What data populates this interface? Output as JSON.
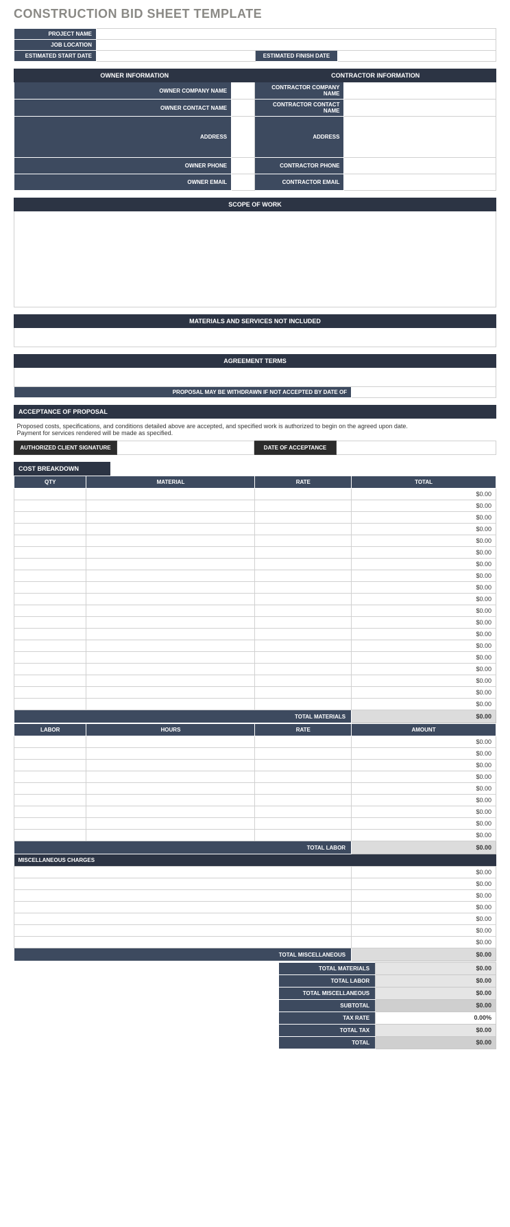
{
  "title": "CONSTRUCTION BID SHEET TEMPLATE",
  "project": {
    "project_name_label": "PROJECT NAME",
    "job_location_label": "JOB LOCATION",
    "est_start_label": "ESTIMATED START DATE",
    "est_finish_label": "ESTIMATED FINISH DATE"
  },
  "owner": {
    "header": "OWNER INFORMATION",
    "company_label": "OWNER COMPANY NAME",
    "contact_label": "OWNER CONTACT NAME",
    "address_label": "ADDRESS",
    "phone_label": "OWNER PHONE",
    "email_label": "OWNER EMAIL"
  },
  "contractor": {
    "header": "CONTRACTOR INFORMATION",
    "company_label": "CONTRACTOR  COMPANY NAME",
    "contact_label": "CONTRACTOR  CONTACT NAME",
    "address_label": "ADDRESS",
    "phone_label": "CONTRACTOR PHONE",
    "email_label": "CONTRACTOR EMAIL"
  },
  "scope_header": "SCOPE OF WORK",
  "not_included_header": "MATERIALS AND SERVICES NOT INCLUDED",
  "agreement_header": "AGREEMENT TERMS",
  "withdraw_label": "PROPOSAL MAY BE WITHDRAWN IF NOT ACCEPTED BY DATE OF",
  "acceptance_header": "ACCEPTANCE OF PROPOSAL",
  "acceptance_text_1": "Proposed costs, specifications, and conditions detailed above are accepted, and specified work is authorized to begin on the agreed upon date.",
  "acceptance_text_2": "Payment for services rendered will be made as specified.",
  "signature_label": "AUTHORIZED CLIENT SIGNATURE",
  "date_accept_label": "DATE OF ACCEPTANCE",
  "cost_breakdown_header": "COST BREAKDOWN",
  "materials_table": {
    "col_qty": "QTY",
    "col_material": "MATERIAL",
    "col_rate": "RATE",
    "col_total": "TOTAL",
    "rows": [
      {
        "total": "$0.00"
      },
      {
        "total": "$0.00"
      },
      {
        "total": "$0.00"
      },
      {
        "total": "$0.00"
      },
      {
        "total": "$0.00"
      },
      {
        "total": "$0.00"
      },
      {
        "total": "$0.00"
      },
      {
        "total": "$0.00"
      },
      {
        "total": "$0.00"
      },
      {
        "total": "$0.00"
      },
      {
        "total": "$0.00"
      },
      {
        "total": "$0.00"
      },
      {
        "total": "$0.00"
      },
      {
        "total": "$0.00"
      },
      {
        "total": "$0.00"
      },
      {
        "total": "$0.00"
      },
      {
        "total": "$0.00"
      },
      {
        "total": "$0.00"
      },
      {
        "total": "$0.00"
      }
    ],
    "subtotal_label": "TOTAL MATERIALS",
    "subtotal_value": "$0.00"
  },
  "labor_table": {
    "col_labor": "LABOR",
    "col_hours": "HOURS",
    "col_rate": "RATE",
    "col_amount": "AMOUNT",
    "rows": [
      {
        "amount": "$0.00"
      },
      {
        "amount": "$0.00"
      },
      {
        "amount": "$0.00"
      },
      {
        "amount": "$0.00"
      },
      {
        "amount": "$0.00"
      },
      {
        "amount": "$0.00"
      },
      {
        "amount": "$0.00"
      },
      {
        "amount": "$0.00"
      },
      {
        "amount": "$0.00"
      }
    ],
    "subtotal_label": "TOTAL LABOR",
    "subtotal_value": "$0.00"
  },
  "misc_table": {
    "header": "MISCELLANEOUS CHARGES",
    "rows": [
      {
        "amount": "$0.00"
      },
      {
        "amount": "$0.00"
      },
      {
        "amount": "$0.00"
      },
      {
        "amount": "$0.00"
      },
      {
        "amount": "$0.00"
      },
      {
        "amount": "$0.00"
      },
      {
        "amount": "$0.00"
      }
    ],
    "subtotal_label": "TOTAL MISCELLANEOUS",
    "subtotal_value": "$0.00"
  },
  "summary": {
    "total_materials_label": "TOTAL MATERIALS",
    "total_materials_value": "$0.00",
    "total_labor_label": "TOTAL LABOR",
    "total_labor_value": "$0.00",
    "total_misc_label": "TOTAL MISCELLANEOUS",
    "total_misc_value": "$0.00",
    "subtotal_label": "SUBTOTAL",
    "subtotal_value": "$0.00",
    "tax_rate_label": "TAX RATE",
    "tax_rate_value": "0.00%",
    "total_tax_label": "TOTAL TAX",
    "total_tax_value": "$0.00",
    "total_label": "TOTAL",
    "total_value": "$0.00"
  }
}
